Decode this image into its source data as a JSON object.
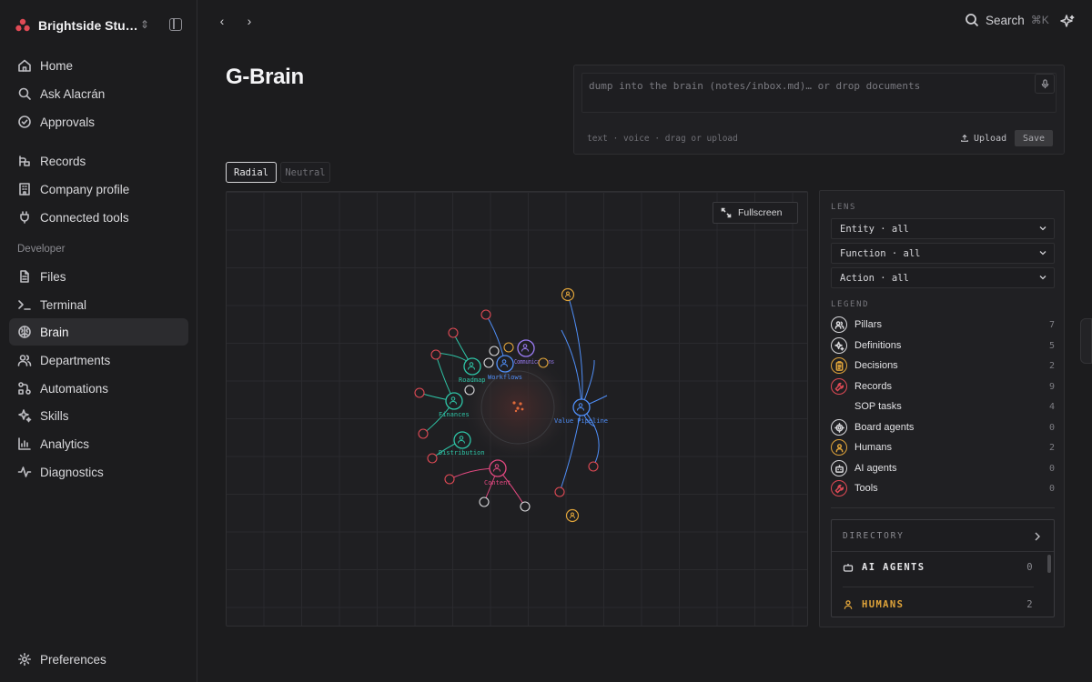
{
  "workspace": {
    "name": "Brightside Stu…"
  },
  "nav": {
    "primary": [
      {
        "label": "Home",
        "icon": "home-icon"
      },
      {
        "label": "Ask Alacrán",
        "icon": "search-icon"
      },
      {
        "label": "Approvals",
        "icon": "check-circle-icon"
      }
    ],
    "secondary": [
      {
        "label": "Records",
        "icon": "records-icon"
      },
      {
        "label": "Company profile",
        "icon": "building-icon"
      },
      {
        "label": "Connected tools",
        "icon": "plug-icon"
      }
    ],
    "developer_label": "Developer",
    "developer": [
      {
        "label": "Files",
        "icon": "file-icon"
      },
      {
        "label": "Terminal",
        "icon": "terminal-icon"
      },
      {
        "label": "Brain",
        "icon": "brain-icon",
        "active": true
      },
      {
        "label": "Departments",
        "icon": "users-icon"
      },
      {
        "label": "Automations",
        "icon": "workflow-icon"
      },
      {
        "label": "Skills",
        "icon": "sparkles-icon"
      },
      {
        "label": "Analytics",
        "icon": "bar-chart-icon"
      },
      {
        "label": "Diagnostics",
        "icon": "activity-icon"
      }
    ],
    "footer": {
      "label": "Preferences",
      "icon": "gear-icon"
    }
  },
  "topbar": {
    "search_label": "Search",
    "search_shortcut": "⌘K"
  },
  "page": {
    "title": "G-Brain"
  },
  "inbox": {
    "placeholder": "dump into the brain (notes/inbox.md)… or drop documents",
    "hint": "text · voice · drag or upload",
    "upload_label": "Upload",
    "save_label": "Save"
  },
  "modes": [
    {
      "label": "Radial",
      "active": true
    },
    {
      "label": "Neutral",
      "active": false
    }
  ],
  "canvas": {
    "fullscreen_label": "Fullscreen"
  },
  "graph": {
    "pillars": [
      {
        "label": "Roadmap",
        "color": "#2ec4a6"
      },
      {
        "label": "Workflows",
        "color": "#4f8ef7"
      },
      {
        "label": "Communications",
        "color": "#9b7cf4"
      },
      {
        "label": "Finances",
        "color": "#2ec4a6"
      },
      {
        "label": "Value Pipeline",
        "color": "#4f8ef7"
      },
      {
        "label": "Distribution",
        "color": "#2ec4a6"
      },
      {
        "label": "Content",
        "color": "#e0487f"
      }
    ]
  },
  "lens": {
    "label": "LENS",
    "filters": [
      {
        "label": "Entity · all"
      },
      {
        "label": "Function · all"
      },
      {
        "label": "Action · all"
      }
    ],
    "legend_label": "LEGEND",
    "legend": [
      {
        "label": "Pillars",
        "count": "7",
        "icon": "users-icon",
        "color": "#d9d9dc"
      },
      {
        "label": "Definitions",
        "count": "5",
        "icon": "sparkles-icon",
        "color": "#d9d9dc"
      },
      {
        "label": "Decisions",
        "count": "2",
        "icon": "clipboard-icon",
        "color": "#e0a43a"
      },
      {
        "label": "Records",
        "count": "9",
        "icon": "wrench-icon",
        "color": "#e04a55"
      },
      {
        "label": "SOP tasks",
        "count": "4",
        "icon": "",
        "color": ""
      },
      {
        "label": "Board agents",
        "count": "0",
        "icon": "cog-icon",
        "color": "#d9d9dc"
      },
      {
        "label": "Humans",
        "count": "2",
        "icon": "person-icon",
        "color": "#e0a43a"
      },
      {
        "label": "AI agents",
        "count": "0",
        "icon": "bot-icon",
        "color": "#d9d9dc"
      },
      {
        "label": "Tools",
        "count": "0",
        "icon": "wrench-icon",
        "color": "#e04a55"
      }
    ]
  },
  "directory": {
    "label": "DIRECTORY",
    "rows": [
      {
        "label": "AI AGENTS",
        "count": "0",
        "color": "#e6e6e8",
        "icon": "bot-icon"
      },
      {
        "label": "HUMANS",
        "count": "2",
        "color": "#e0a43a",
        "icon": "person-icon"
      }
    ]
  },
  "colors": {
    "accent_red": "#e04a55",
    "accent_amber": "#e0a43a",
    "accent_blue": "#4f8ef7",
    "accent_teal": "#2ec4a6",
    "accent_pink": "#e0487f",
    "accent_purple": "#9b7cf4"
  }
}
